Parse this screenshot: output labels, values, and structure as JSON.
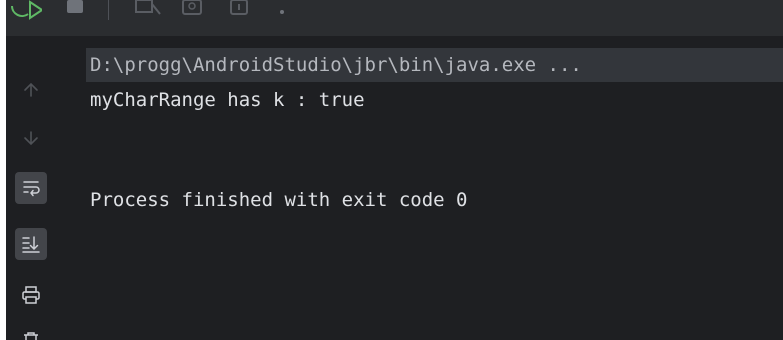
{
  "console": {
    "command_line": "D:\\progg\\AndroidStudio\\jbr\\bin\\java.exe ...",
    "output_line": "myCharRange has k : true",
    "process_line": "Process finished with exit code 0"
  },
  "sidebar": {
    "buttons": [
      {
        "icon": "up-arrow-icon",
        "active": false
      },
      {
        "icon": "down-arrow-icon",
        "active": false
      },
      {
        "icon": "soft-wrap-icon",
        "active": true
      },
      {
        "icon": "scroll-to-end-icon",
        "active": true
      },
      {
        "icon": "print-icon",
        "active": false
      },
      {
        "icon": "trash-icon",
        "active": false
      }
    ]
  },
  "toolbar": {
    "icons": [
      "rerun-icon",
      "stop-icon",
      "camera-icon",
      "restore-layout-icon",
      "pin-icon",
      "more-options-icon"
    ]
  },
  "colors": {
    "background": "#1e1f22",
    "toolbar": "#2b2d30",
    "highlight": "#33363b",
    "text": "#dfe1e5",
    "icon": "#ced0d6",
    "accent_green": "#5fb865"
  }
}
